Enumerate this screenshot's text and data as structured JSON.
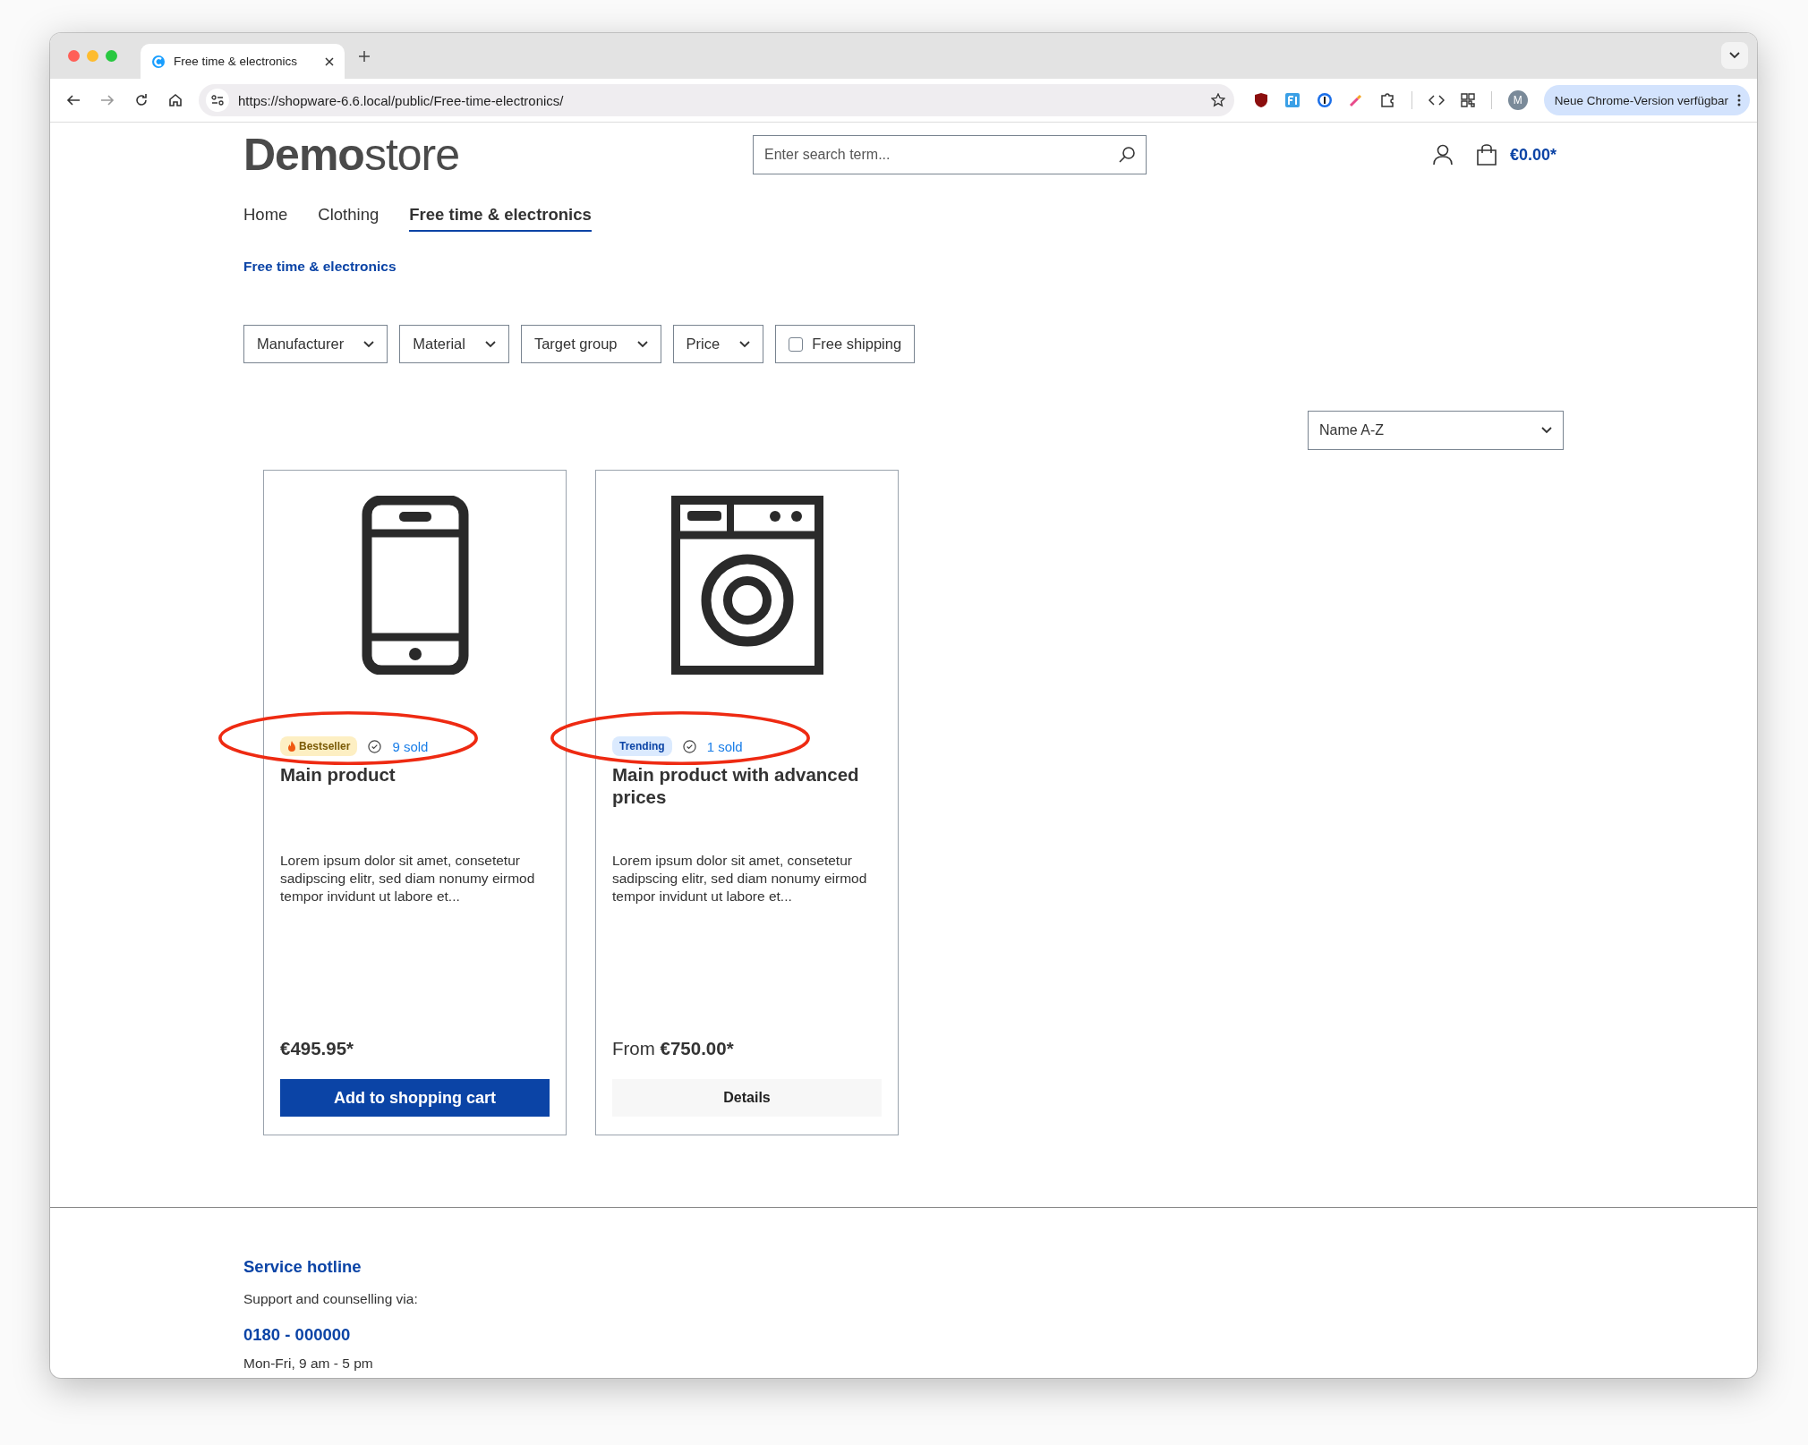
{
  "browser": {
    "tab_title": "Free time & electronics",
    "url": "https://shopware-6.6.local/public/Free-time-electronics/",
    "update_button": "Neue Chrome-Version verfügbar",
    "profile_initial": "M"
  },
  "header": {
    "logo": "**Demo**store",
    "search": {
      "placeholder": "Enter search term..."
    },
    "cart_total": "€0.00*"
  },
  "nav": [
    {
      "label": "Home",
      "selected": false
    },
    {
      "label": "Clothing",
      "selected": false
    },
    {
      "label": "Free time & electronics",
      "selected": true
    }
  ],
  "breadcrumb": "Free time & electronics",
  "filters": [
    {
      "kind": "dropdown",
      "label": "Manufacturer"
    },
    {
      "kind": "dropdown",
      "label": "Material"
    },
    {
      "kind": "dropdown",
      "label": "Target group"
    },
    {
      "kind": "dropdown",
      "label": "Price"
    },
    {
      "kind": "checkbox",
      "label": "Free shipping",
      "checked": false
    }
  ],
  "sorting": {
    "value": "Name A-Z"
  },
  "products": [
    {
      "badge": {
        "kind": "bestseller",
        "label": "Bestseller"
      },
      "sold": "9 sold",
      "highlighted": true,
      "name": "Main product",
      "description": "Lorem ipsum dolor sit amet, consetetur sadipscing elitr, sed diam nonumy eirmod tempor invidunt ut labore et...",
      "price": {
        "amount": "€495.95*"
      },
      "button": {
        "kind": "primary",
        "label": "Add to shopping cart"
      }
    },
    {
      "badge": {
        "kind": "trending",
        "label": "Trending"
      },
      "sold": "1 sold",
      "highlighted": true,
      "name": "Main product with advanced prices",
      "description": "Lorem ipsum dolor sit amet, consetetur sadipscing elitr, sed diam nonumy eirmod tempor invidunt ut labore et...",
      "price": {
        "prefix": "From",
        "amount": "€750.00*"
      },
      "button": {
        "kind": "secondary",
        "label": "Details"
      }
    }
  ],
  "footer": {
    "title": "Service hotline",
    "text": "Support and counselling via:",
    "phone": "0180 - 000000",
    "hours": "Mon-Fri, 9 am - 5 pm"
  }
}
